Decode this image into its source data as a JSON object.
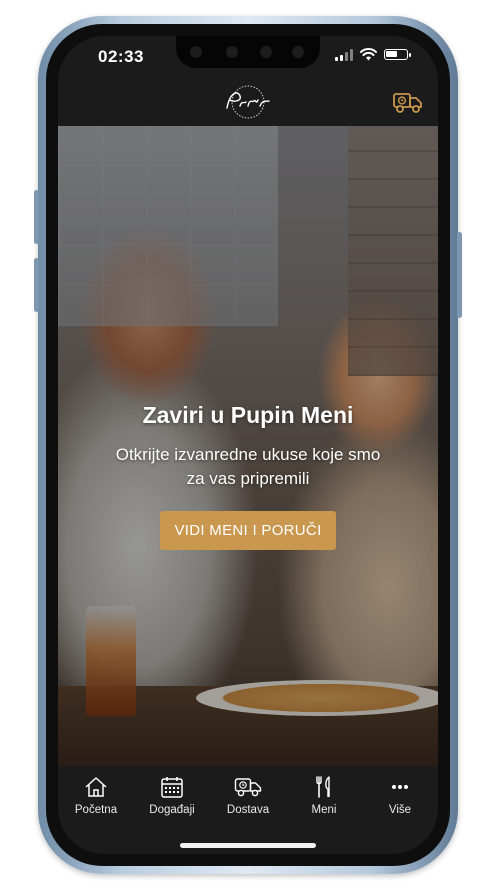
{
  "status_bar": {
    "time": "02:33"
  },
  "brand": {
    "name": "Pupin",
    "accent": "#c9974d"
  },
  "hero": {
    "title": "Zaviri u Pupin Meni",
    "subtitle": "Otkrijte izvanredne ukuse koje smo za vas pripremili",
    "cta_label": "VIDI MENI I PORUČI"
  },
  "tabbar": {
    "items": [
      {
        "label": "Početna",
        "icon": "home-icon"
      },
      {
        "label": "Događaji",
        "icon": "calendar-icon"
      },
      {
        "label": "Dostava",
        "icon": "delivery-truck-icon"
      },
      {
        "label": "Meni",
        "icon": "fork-knife-icon"
      },
      {
        "label": "Više",
        "icon": "more-dots-icon"
      }
    ]
  },
  "colors": {
    "app_background": "#1b1b1b",
    "text": "#ffffff",
    "accent": "#c9974d"
  }
}
